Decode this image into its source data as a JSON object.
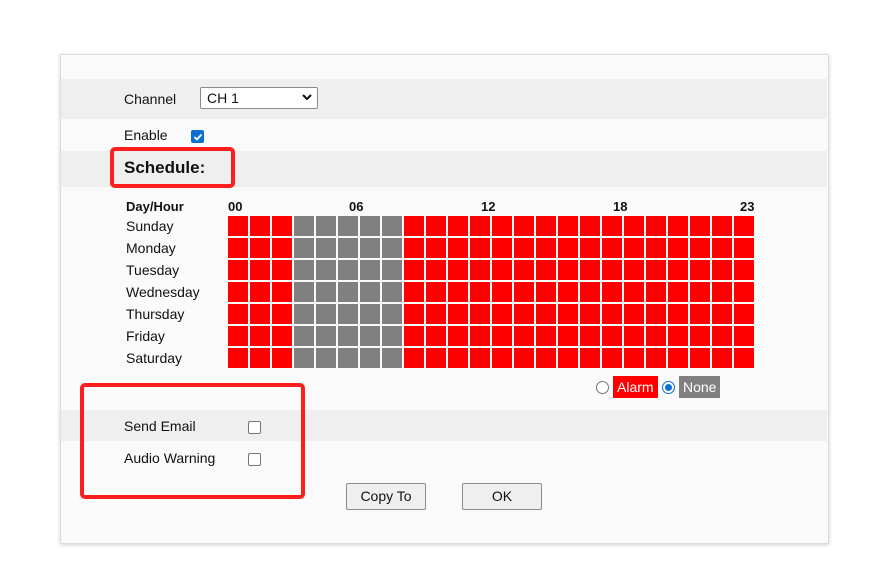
{
  "channel": {
    "label": "Channel",
    "selected": "CH 1"
  },
  "enable": {
    "label": "Enable",
    "checked": true
  },
  "schedule": {
    "title": "Schedule:",
    "corner_header": "Day/Hour",
    "hour_labels": [
      "00",
      "06",
      "12",
      "18",
      "23"
    ],
    "days": [
      "Sunday",
      "Monday",
      "Tuesday",
      "Wednesday",
      "Thursday",
      "Friday",
      "Saturday"
    ],
    "hours_per_day": 24,
    "none_hours": [
      3,
      4,
      5,
      6,
      7
    ],
    "colors": {
      "alarm": "#ff0000",
      "none": "#808080"
    },
    "legend": {
      "alarm_label": "Alarm",
      "none_label": "None",
      "selected": "none"
    }
  },
  "options": {
    "send_email_label": "Send Email",
    "send_email_checked": false,
    "audio_warning_label": "Audio Warning",
    "audio_warning_checked": false
  },
  "buttons": {
    "copy_to": "Copy To",
    "ok": "OK"
  },
  "highlight_color": "#ff1e1e"
}
